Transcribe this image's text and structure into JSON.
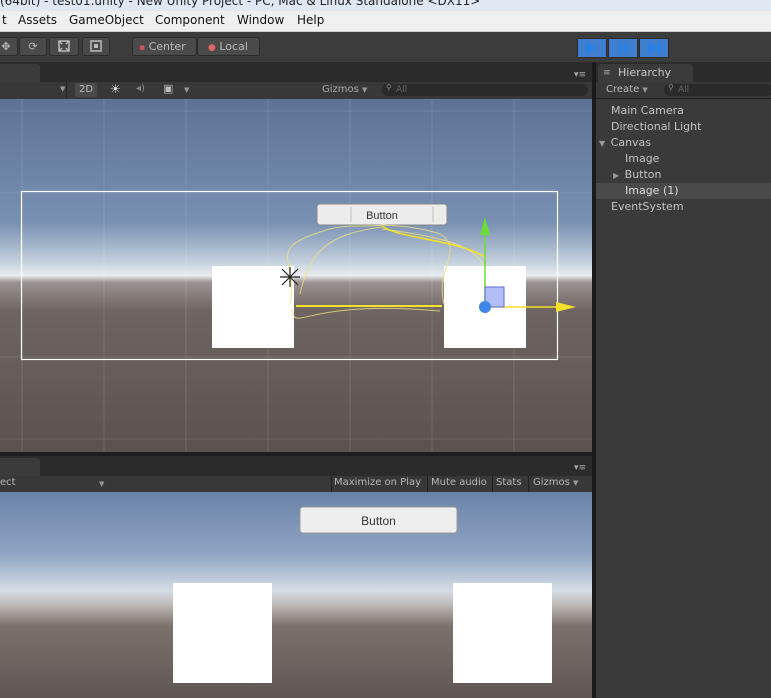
{
  "window": {
    "title": "(64bit) - test01.unity - New Unity Project - PC, Mac & Linux Standalone  <DX11>"
  },
  "menu": [
    "t",
    "Assets",
    "GameObject",
    "Component",
    "Window",
    "Help"
  ],
  "toolbar": {
    "pivot_label": "Center",
    "space_label": "Local"
  },
  "scene": {
    "mode_2d": "2D",
    "gizmos": "Gizmos",
    "search_placeholder": "All",
    "button_label": "Button"
  },
  "game": {
    "display_label": "ect",
    "maximize_on_play": "Maximize on Play",
    "mute_audio": "Mute audio",
    "stats": "Stats",
    "gizmos": "Gizmos",
    "button_label": "Button"
  },
  "hierarchy": {
    "tab_label": "Hierarchy",
    "create_label": "Create",
    "search_placeholder": "All",
    "items": [
      {
        "label": "Main Camera",
        "indent": 0
      },
      {
        "label": "Directional Light",
        "indent": 0
      },
      {
        "label": "Canvas",
        "indent": 0,
        "expanded": true
      },
      {
        "label": "Image",
        "indent": 1
      },
      {
        "label": "Button",
        "indent": 1,
        "collapsed": true
      },
      {
        "label": "Image (1)",
        "indent": 1,
        "selected": true
      },
      {
        "label": "EventSystem",
        "indent": 0
      }
    ]
  },
  "colors": {
    "play_active": "#3c84d8",
    "gizmo_yellow": "#f3e12a",
    "gizmo_green": "#6bdc3a"
  }
}
